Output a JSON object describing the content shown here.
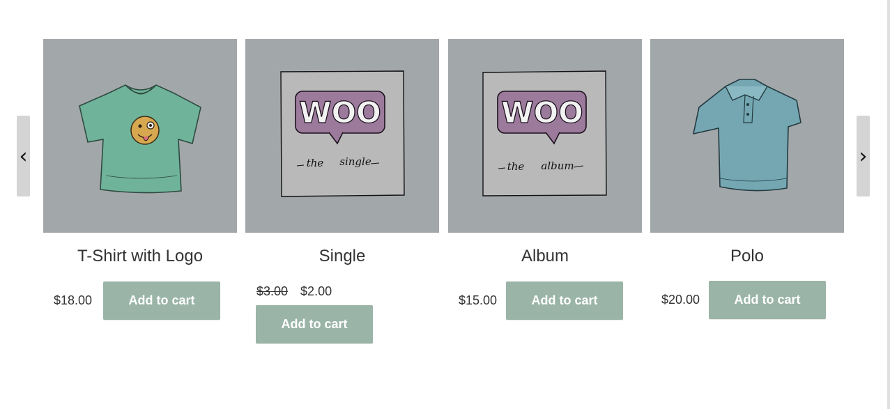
{
  "nav": {
    "prev_icon": "‹",
    "next_icon": "›"
  },
  "products": [
    {
      "name": "T-Shirt with Logo",
      "price": "$18.00",
      "button": "Add to cart"
    },
    {
      "name": "Single",
      "old_price": "$3.00",
      "price": "$2.00",
      "button": "Add to cart",
      "image_text": {
        "logo": "WOO",
        "caption_left": "the",
        "caption_right": "single"
      }
    },
    {
      "name": "Album",
      "price": "$15.00",
      "button": "Add to cart",
      "image_text": {
        "logo": "WOO",
        "caption_left": "the",
        "caption_right": "album"
      }
    },
    {
      "name": "Polo",
      "price": "$20.00",
      "button": "Add to cart"
    }
  ],
  "colors": {
    "image_bg": "#a2a7aa",
    "button_bg": "#9ab4a7",
    "tshirt": "#6fb39a",
    "polo": "#74a7b2",
    "woo_bubble": "#9b7a9c"
  }
}
